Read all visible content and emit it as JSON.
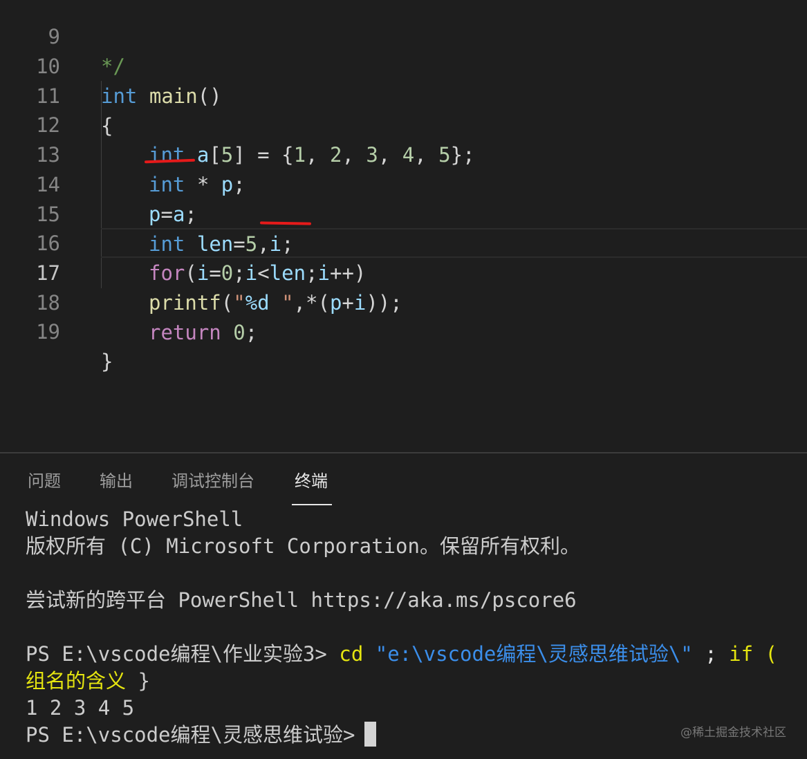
{
  "editor": {
    "lines": [
      {
        "num": "9",
        "parts": [
          "*/"
        ]
      },
      {
        "num": "10",
        "parts": [
          "int",
          " ",
          "main",
          "()"
        ]
      },
      {
        "num": "11",
        "parts": [
          "{"
        ]
      },
      {
        "num": "12",
        "parts": [
          "int",
          " ",
          "a",
          "[",
          "5",
          "] = {",
          "1",
          ", ",
          "2",
          ", ",
          "3",
          ", ",
          "4",
          ", ",
          "5",
          "};"
        ]
      },
      {
        "num": "13",
        "parts": [
          "int",
          " * ",
          "p",
          ";"
        ]
      },
      {
        "num": "14",
        "parts": [
          "p",
          "=",
          "a",
          ";"
        ]
      },
      {
        "num": "15",
        "parts": [
          "int",
          " ",
          "len",
          "=",
          "5",
          ",",
          "i",
          ";"
        ]
      },
      {
        "num": "16",
        "parts": [
          "for",
          "(",
          "i",
          "=",
          "0",
          ";",
          "i",
          "<",
          "len",
          ";",
          "i",
          "++)"
        ]
      },
      {
        "num": "17",
        "parts": [
          "printf",
          "(",
          "\"",
          "%d",
          " \"",
          ",*(",
          "p",
          "+",
          "i",
          "));"
        ]
      },
      {
        "num": "18",
        "parts": [
          "return",
          " ",
          "0",
          ";"
        ]
      },
      {
        "num": "19",
        "parts": [
          "}"
        ]
      }
    ]
  },
  "panel": {
    "tabs": [
      "问题",
      "输出",
      "调试控制台",
      "终端"
    ],
    "active_tab": "终端",
    "terminal": {
      "line1": "Windows PowerShell",
      "line2": "版权所有 (C) Microsoft Corporation。保留所有权利。",
      "line3": "尝试新的跨平台 PowerShell https://aka.ms/pscore6",
      "prompt1": "PS E:\\vscode编程\\作业实验3>",
      "cmd": "cd",
      "cmd_arg": "\"e:\\vscode编程\\灵感思维试验\\\"",
      "cmd_sep": ";",
      "cmd_if": "if (",
      "line5": "组名的含义",
      "line5_tail": "}",
      "output": "1 2 3 4 5",
      "prompt2": "PS E:\\vscode编程\\灵感思维试验>"
    }
  },
  "watermark": "@稀土掘金技术社区",
  "colors": {
    "background": "#1e1e1e",
    "keyword": "#569cd6",
    "function": "#dcdcaa",
    "variable": "#9cdcfe",
    "number": "#b5cea8",
    "string": "#ce9178",
    "control": "#c586c0",
    "red_mark": "#e51a1a"
  }
}
